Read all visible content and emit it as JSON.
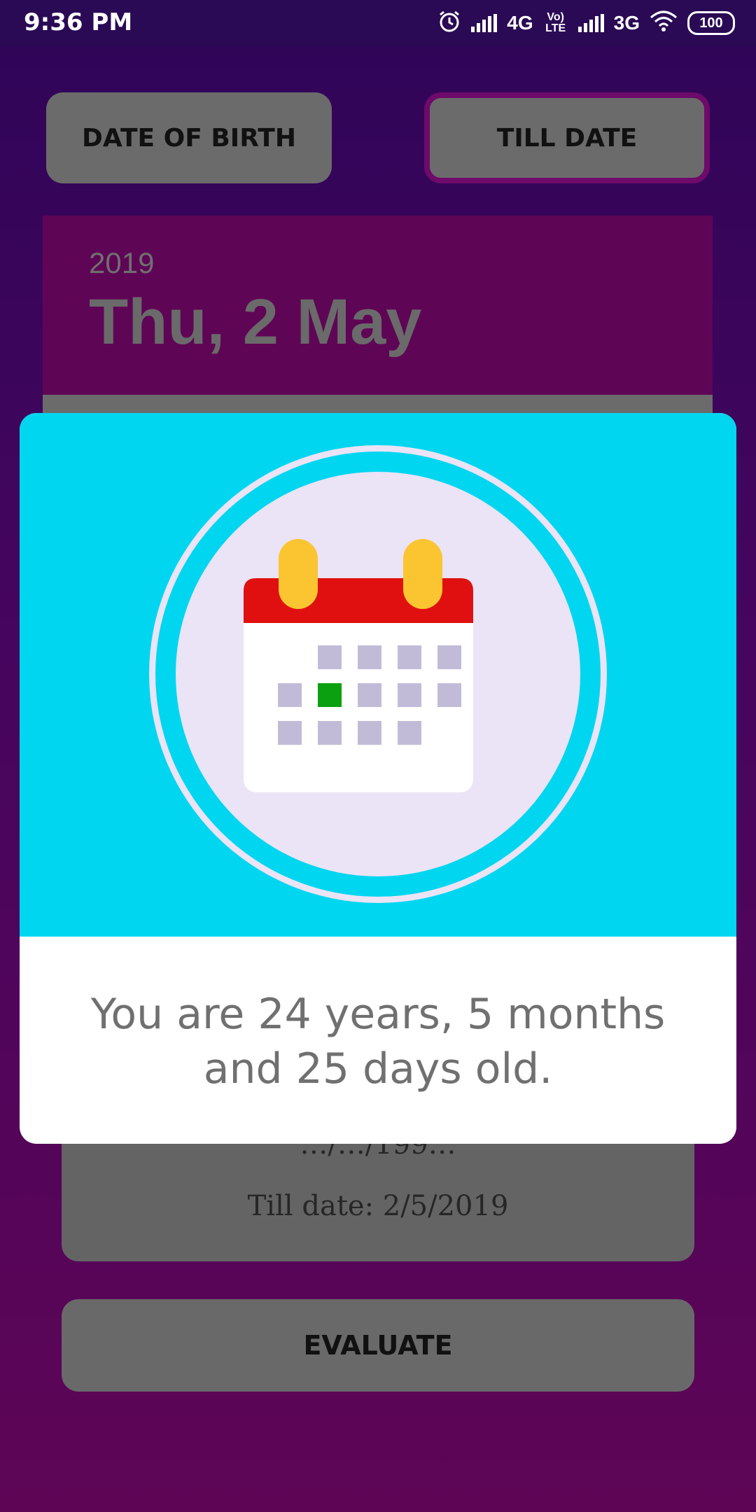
{
  "status_bar": {
    "time": "9:36 PM",
    "network_1": "4G",
    "volte": "Vo) LTE",
    "network_2": "3G",
    "battery": "100",
    "icons": [
      "alarm-icon",
      "signal-icon",
      "wifi-icon",
      "battery-icon"
    ]
  },
  "buttons": {
    "date_of_birth": "DATE OF BIRTH",
    "till_date": "TILL DATE",
    "evaluate": "EVALUATE"
  },
  "date_picker": {
    "year": "2019",
    "date": "Thu, 2 May"
  },
  "info": {
    "dob_line": "…/…/199…",
    "till_line": "Till date: 2/5/2019"
  },
  "dialog": {
    "icon": "calendar-icon",
    "result": "You are 24 years, 5 months and 25 days old."
  },
  "colors": {
    "dialog_header": "#00d6f0",
    "calendar_top": "#e01010",
    "calendar_ring": "#fbc531",
    "highlight_day": "#0aa010",
    "day_cell": "#c2bbd8"
  }
}
